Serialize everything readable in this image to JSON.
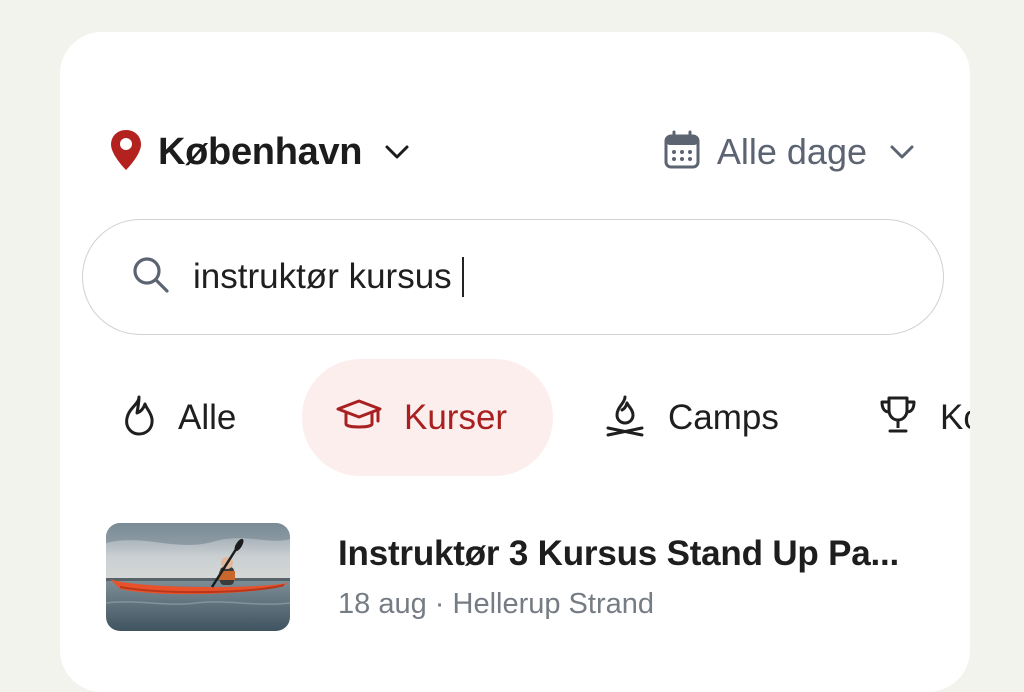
{
  "header": {
    "location": "København",
    "date_filter": "Alle dage"
  },
  "search": {
    "value": "instruktør kursus"
  },
  "categories": [
    {
      "label": "Alle",
      "icon": "flame-icon",
      "active": false
    },
    {
      "label": "Kurser",
      "icon": "graduation-cap-icon",
      "active": true
    },
    {
      "label": "Camps",
      "icon": "campfire-icon",
      "active": false
    },
    {
      "label": "Ko",
      "icon": "trophy-icon",
      "active": false
    }
  ],
  "results": [
    {
      "title": "Instruktør 3 Kursus Stand Up Pa...",
      "date": "18 aug",
      "separator": "·",
      "place": "Hellerup Strand"
    }
  ],
  "colors": {
    "accent": "#a8201f",
    "accent_bg": "#fdeeee",
    "muted": "#5c6472",
    "background": "#f3f3ee"
  }
}
